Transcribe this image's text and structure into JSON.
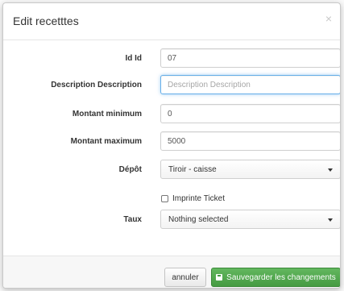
{
  "dialog": {
    "title": "Edit recetttes",
    "close_glyph": "×"
  },
  "fields": {
    "id": {
      "label": "Id Id",
      "value": "07"
    },
    "description": {
      "label": "Description Description",
      "value": "",
      "placeholder": "Description Description"
    },
    "montant_min": {
      "label": "Montant minimum",
      "value": "0"
    },
    "montant_max": {
      "label": "Montant maximum",
      "value": "5000"
    },
    "depot": {
      "label": "Dépôt",
      "selected": "Tiroir - caisse"
    },
    "imprime": {
      "label": "Imprinte Ticket",
      "checked": false
    },
    "taux": {
      "label": "Taux",
      "selected": "Nothing selected"
    }
  },
  "footer": {
    "cancel_label": "annuler",
    "save_label": "Sauvegarder les changements",
    "save_icon": "floppy-disk-icon"
  },
  "colors": {
    "save_button": "#459b42",
    "focus_border": "#66afe9"
  }
}
